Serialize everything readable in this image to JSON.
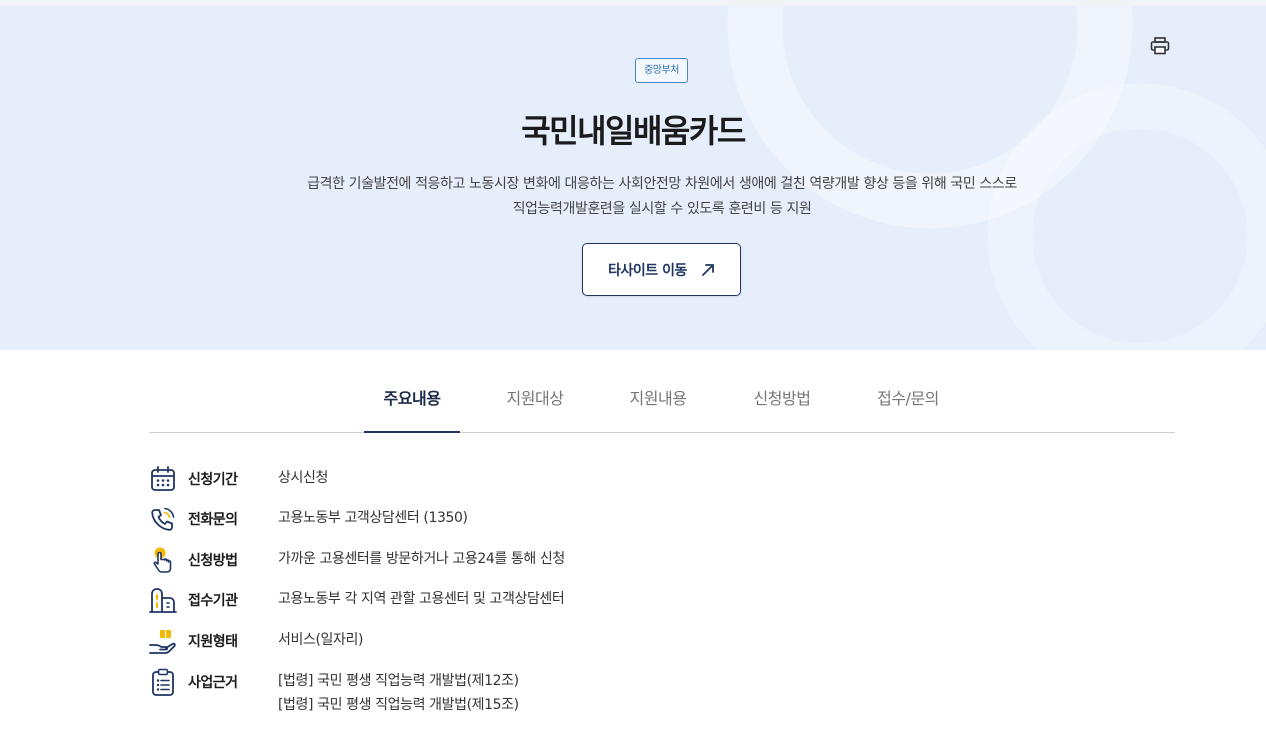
{
  "hero": {
    "badge": "중앙부처",
    "title": "국민내일배움카드",
    "desc_line1": "급격한 기술발전에 적응하고 노동시장 변화에 대응하는 사회안전망 차원에서 생애에 걸친 역량개발 향상 등을 위해 국민 스스로",
    "desc_line2": "직업능력개발훈련을 실시할 수 있도록 훈련비 등 지원",
    "site_button_label": "타사이트 이동",
    "print_icon": "printer-icon"
  },
  "tabs": [
    {
      "label": "주요내용",
      "active": true
    },
    {
      "label": "지원대상",
      "active": false
    },
    {
      "label": "지원내용",
      "active": false
    },
    {
      "label": "신청방법",
      "active": false
    },
    {
      "label": "접수/문의",
      "active": false
    }
  ],
  "details": [
    {
      "icon": "calendar-icon",
      "label": "신청기간",
      "values": [
        "상시신청"
      ]
    },
    {
      "icon": "phone-icon",
      "label": "전화문의",
      "values": [
        "고용노동부 고객상담센터 (1350)"
      ]
    },
    {
      "icon": "hand-pointer-icon",
      "label": "신청방법",
      "values": [
        "가까운 고용센터를 방문하거나 고용24를 통해 신청"
      ]
    },
    {
      "icon": "building-icon",
      "label": "접수기관",
      "values": [
        "고용노동부 각 지역 관할 고용센터 및 고객상담센터"
      ]
    },
    {
      "icon": "hand-giving-icon",
      "label": "지원형태",
      "values": [
        "서비스(일자리)"
      ]
    },
    {
      "icon": "clipboard-list-icon",
      "label": "사업근거",
      "values": [
        "[법령] 국민 평생 직업능력 개발법(제12조)",
        "[법령] 국민 평생 직업능력 개발법(제15조)"
      ]
    }
  ],
  "colors": {
    "hero_bg": "#e6eefc",
    "accent_navy": "#1f3564",
    "icon_yellow": "#f5b800",
    "badge_blue": "#2c6cb0"
  }
}
